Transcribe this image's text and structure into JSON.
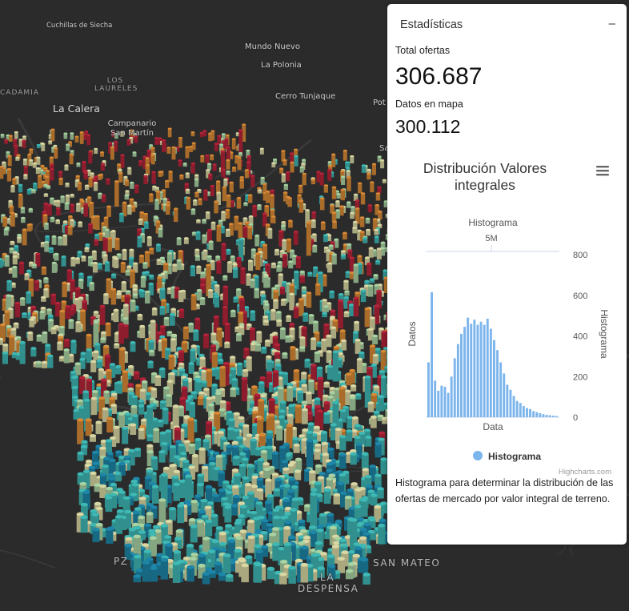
{
  "map": {
    "place_labels": [
      "Cuchillas de Siecha",
      "Mundo Nuevo",
      "La Polonia",
      "CADAMIA",
      "LOS LAURELES",
      "La Calera",
      "Cerro Tunjaque",
      "Campanario San Martín",
      "Pot",
      "Sa",
      "SAN MATEO",
      "LA DESPENSA",
      "PZ"
    ],
    "colors": {
      "background": "#2b2b2c",
      "teal": "#3fb9b5",
      "blue": "#1e86a8",
      "cream": "#d9d7a3",
      "lightgreen": "#a9d3a3",
      "orange": "#d98a36",
      "red": "#b5243a"
    }
  },
  "panel": {
    "title": "Estadísticas",
    "collapse_icon": "minus-icon",
    "total_label": "Total ofertas",
    "total_value": "306.687",
    "map_label": "Datos en mapa",
    "map_value": "300.112",
    "menu_icon": "hamburger-menu-icon",
    "credit": "Highcharts.com",
    "description": "Histograma para determinar la distribución de las ofertas de mercado por valor integral de terreno."
  },
  "chart_data": {
    "type": "bar",
    "title": "Distribución Valores integrales",
    "xlabel": "Data",
    "ylabel": "Datos",
    "top_axis_title": "Histograma",
    "top_axis_tick": "5M",
    "right_axis_title": "Histograma",
    "right_ticks": [
      "800",
      "600",
      "400",
      "200",
      "0"
    ],
    "ylim": [
      0,
      800
    ],
    "series": [
      {
        "name": "Histograma",
        "color": "#7cb5ec",
        "values": [
          270,
          615,
          180,
          130,
          155,
          150,
          120,
          200,
          290,
          360,
          410,
          445,
          490,
          460,
          480,
          455,
          470,
          455,
          485,
          435,
          380,
          330,
          270,
          215,
          160,
          135,
          105,
          80,
          70,
          55,
          45,
          40,
          30,
          25,
          20,
          15,
          12,
          10,
          8,
          6
        ]
      }
    ],
    "legend": "bottom-center",
    "grid": false
  }
}
